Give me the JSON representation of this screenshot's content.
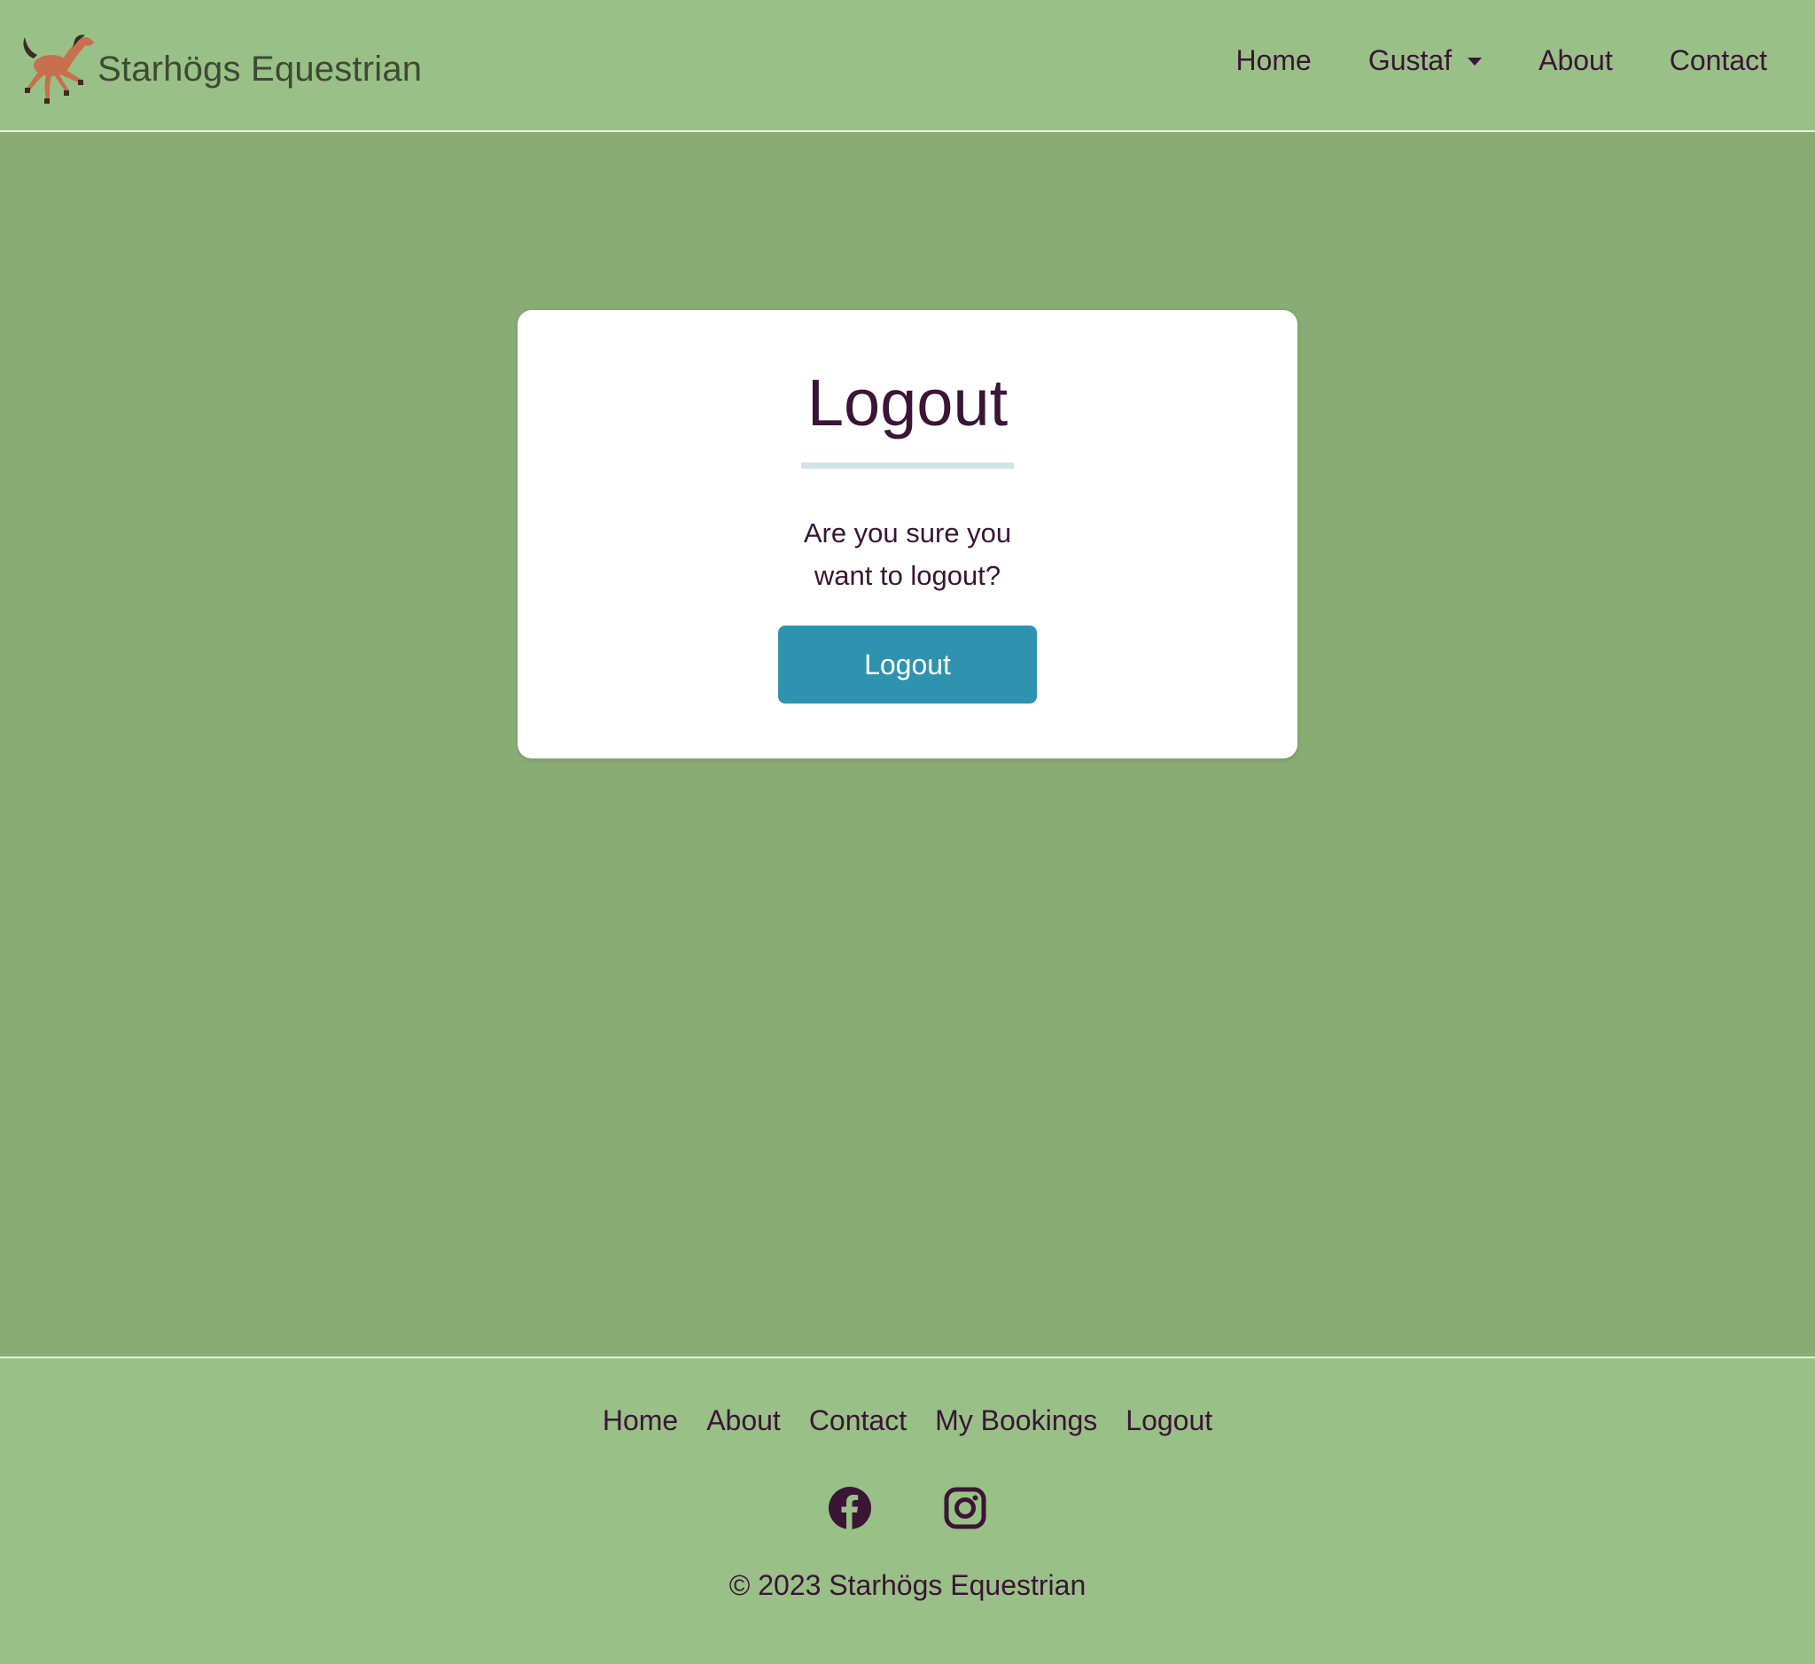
{
  "brand": {
    "name": "Starhögs Equestrian",
    "logo_icon": "horse-icon"
  },
  "nav": {
    "items": [
      {
        "label": "Home"
      },
      {
        "label": "Gustaf",
        "has_dropdown": true
      },
      {
        "label": "About"
      },
      {
        "label": "Contact"
      }
    ]
  },
  "card": {
    "title": "Logout",
    "message_line1": "Are you sure you",
    "message_line2": "want to logout?",
    "button_label": "Logout"
  },
  "footer": {
    "links": [
      {
        "label": "Home"
      },
      {
        "label": "About"
      },
      {
        "label": "Contact"
      },
      {
        "label": "My Bookings"
      },
      {
        "label": "Logout"
      }
    ],
    "social_icons": [
      "facebook-icon",
      "instagram-icon"
    ],
    "copyright": "© 2023 Starhögs Equestrian"
  },
  "colors": {
    "header_bg": "#99c086",
    "page_bg": "#89ac75",
    "text": "#3a1536",
    "button_bg": "#2e93ae",
    "underline": "#cfe3ea"
  }
}
